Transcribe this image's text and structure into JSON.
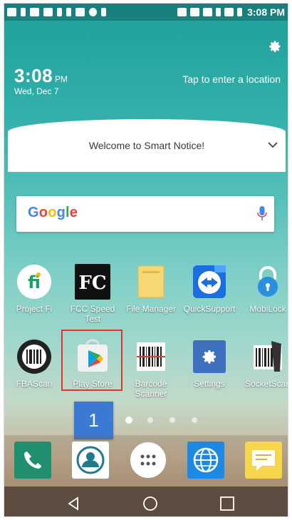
{
  "status_bar": {
    "time": "3:08 PM"
  },
  "clock_widget": {
    "time": "3:08",
    "ampm": "PM",
    "date": "Wed, Dec 7",
    "location_prompt": "Tap to enter a location"
  },
  "smart_notice": {
    "text": "Welcome to Smart Notice!"
  },
  "search": {
    "logo_letters": [
      "G",
      "o",
      "o",
      "g",
      "l",
      "e"
    ],
    "logo_colors": [
      "#4285F4",
      "#EA4335",
      "#FBBC05",
      "#4285F4",
      "#34A853",
      "#EA4335"
    ]
  },
  "apps_row1": [
    {
      "label": "Project Fi"
    },
    {
      "label": "FCC Speed Test"
    },
    {
      "label": "File Manager"
    },
    {
      "label": "QuickSupport"
    },
    {
      "label": "MobiLock"
    }
  ],
  "apps_row2": [
    {
      "label": "FBAScan"
    },
    {
      "label": "Play Store"
    },
    {
      "label": "Barcode Scanner"
    },
    {
      "label": "Settings"
    },
    {
      "label": "SocketScan"
    }
  ],
  "fcc_icon_text": "FC",
  "home_page_badge": "1",
  "page_indicator": {
    "count": 4,
    "active_index": 0
  },
  "dock": [
    {
      "name": "phone"
    },
    {
      "name": "contacts"
    },
    {
      "name": "apps-drawer"
    },
    {
      "name": "browser"
    },
    {
      "name": "messaging"
    }
  ],
  "colors": {
    "highlight_border": "#e2342c",
    "page_badge": "#3a7ad4"
  }
}
